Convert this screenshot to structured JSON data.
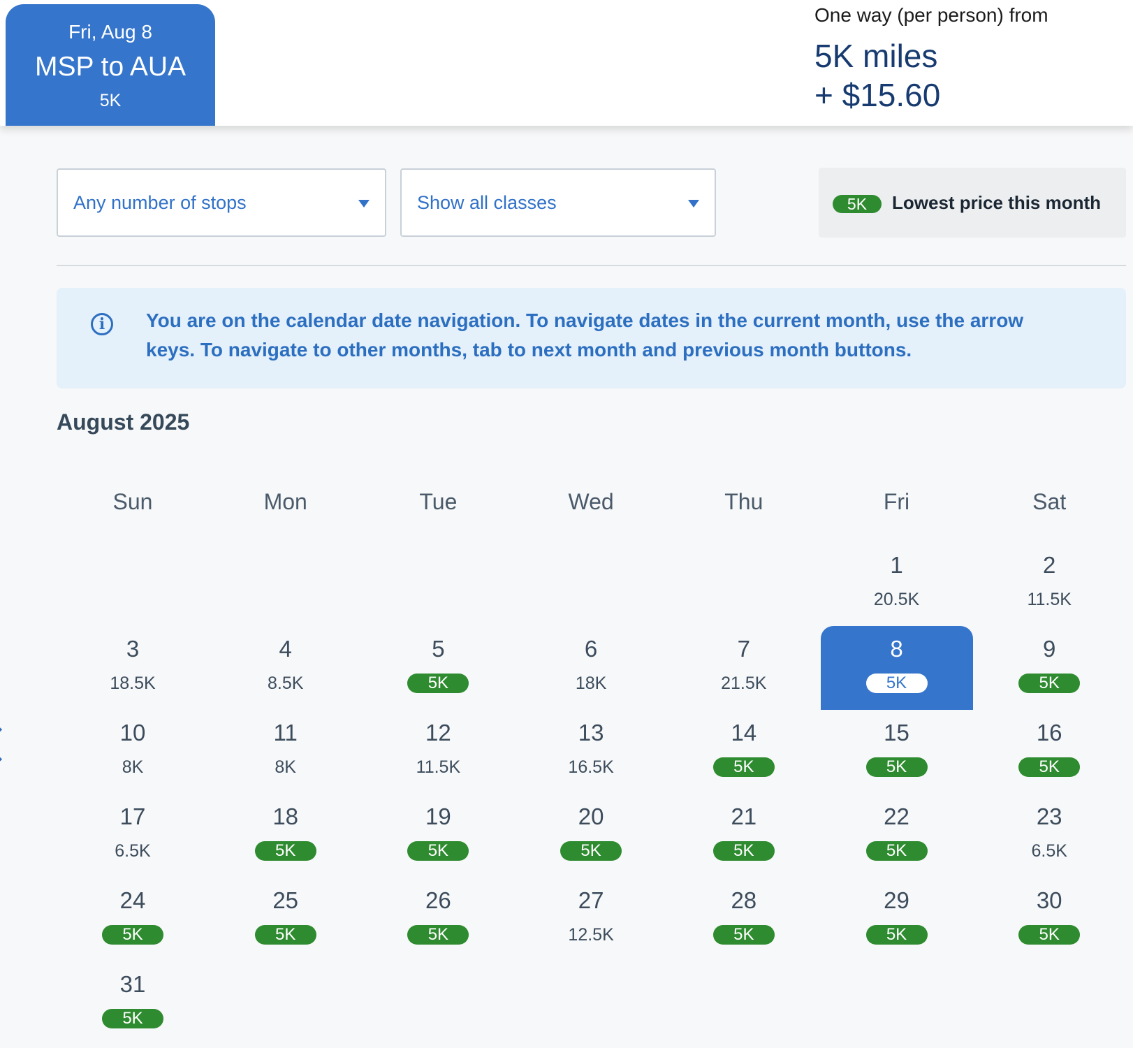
{
  "header": {
    "selected_date": "Fri, Aug 8",
    "route": "MSP to AUA",
    "price": "5K",
    "fare_label": "One way (per person) from",
    "fare_miles": "5K miles",
    "fare_fee": "+ $15.60"
  },
  "filters": {
    "stops": "Any number of stops",
    "classes": "Show all classes"
  },
  "legend": {
    "badge": "5K",
    "text": "Lowest price this month"
  },
  "info": {
    "message": "You are on the calendar date navigation. To navigate dates in the current month, use the arrow keys. To navigate to other months, tab to next month and previous month buttons."
  },
  "calendar": {
    "month": "August 2025",
    "weekdays": [
      "Sun",
      "Mon",
      "Tue",
      "Wed",
      "Thu",
      "Fri",
      "Sat"
    ],
    "selected_day": 8,
    "days": [
      {
        "day": "1",
        "price": "20.5K",
        "lowest": false
      },
      {
        "day": "2",
        "price": "11.5K",
        "lowest": false
      },
      {
        "day": "3",
        "price": "18.5K",
        "lowest": false
      },
      {
        "day": "4",
        "price": "8.5K",
        "lowest": false
      },
      {
        "day": "5",
        "price": "5K",
        "lowest": true
      },
      {
        "day": "6",
        "price": "18K",
        "lowest": false
      },
      {
        "day": "7",
        "price": "21.5K",
        "lowest": false
      },
      {
        "day": "8",
        "price": "5K",
        "lowest": true
      },
      {
        "day": "9",
        "price": "5K",
        "lowest": true
      },
      {
        "day": "10",
        "price": "8K",
        "lowest": false
      },
      {
        "day": "11",
        "price": "8K",
        "lowest": false
      },
      {
        "day": "12",
        "price": "11.5K",
        "lowest": false
      },
      {
        "day": "13",
        "price": "16.5K",
        "lowest": false
      },
      {
        "day": "14",
        "price": "5K",
        "lowest": true
      },
      {
        "day": "15",
        "price": "5K",
        "lowest": true
      },
      {
        "day": "16",
        "price": "5K",
        "lowest": true
      },
      {
        "day": "17",
        "price": "6.5K",
        "lowest": false
      },
      {
        "day": "18",
        "price": "5K",
        "lowest": true
      },
      {
        "day": "19",
        "price": "5K",
        "lowest": true
      },
      {
        "day": "20",
        "price": "5K",
        "lowest": true
      },
      {
        "day": "21",
        "price": "5K",
        "lowest": true
      },
      {
        "day": "22",
        "price": "5K",
        "lowest": true
      },
      {
        "day": "23",
        "price": "6.5K",
        "lowest": false
      },
      {
        "day": "24",
        "price": "5K",
        "lowest": true
      },
      {
        "day": "25",
        "price": "5K",
        "lowest": true
      },
      {
        "day": "26",
        "price": "5K",
        "lowest": true
      },
      {
        "day": "27",
        "price": "12.5K",
        "lowest": false
      },
      {
        "day": "28",
        "price": "5K",
        "lowest": true
      },
      {
        "day": "29",
        "price": "5K",
        "lowest": true
      },
      {
        "day": "30",
        "price": "5K",
        "lowest": true
      },
      {
        "day": "31",
        "price": "5K",
        "lowest": true
      }
    ]
  },
  "colors": {
    "brand_blue": "#3575cc",
    "lowest_green": "#2e8b2f"
  },
  "icons": {
    "info": "info-icon",
    "prev_month": "chevron-left-icon"
  }
}
